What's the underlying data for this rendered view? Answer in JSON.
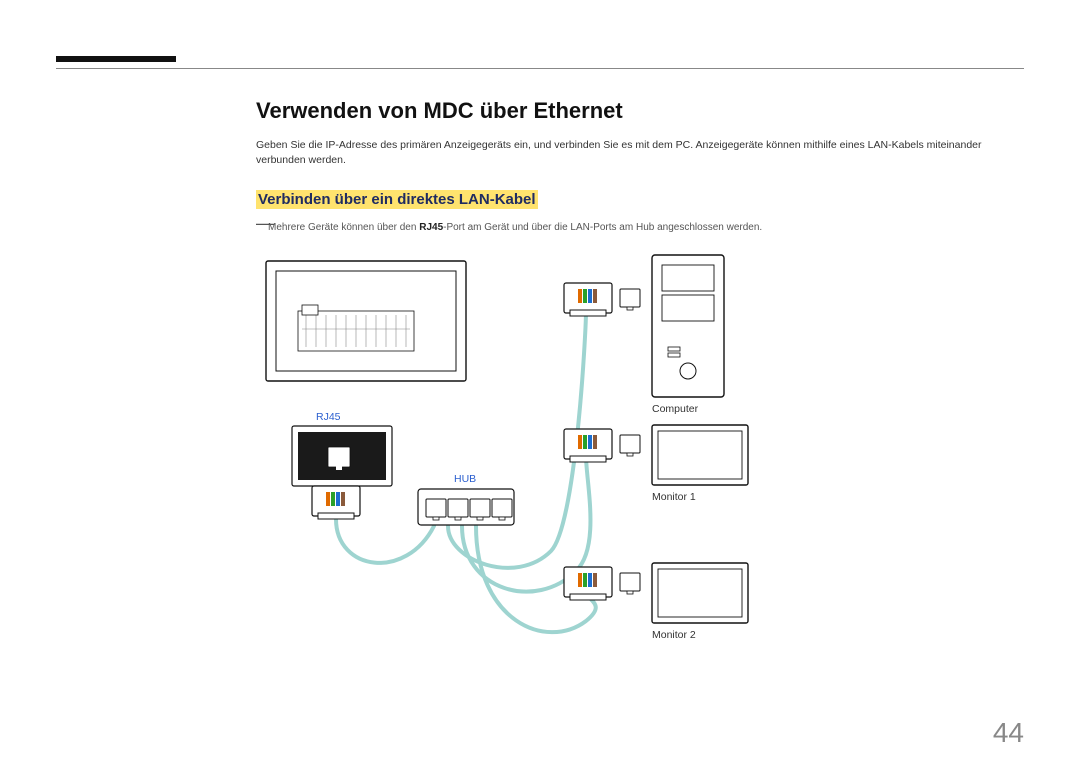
{
  "page": {
    "number": "44",
    "title": "Verwenden von MDC über Ethernet",
    "intro": "Geben Sie die IP-Adresse des primären Anzeigegeräts ein, und verbinden Sie es mit dem PC. Anzeigegeräte können mithilfe eines LAN-Kabels miteinander verbunden werden.",
    "subheading": "Verbinden über ein direktes LAN-Kabel",
    "note_prefix": "Mehrere Geräte können über den ",
    "note_bold": "RJ45",
    "note_suffix": "-Port am Gerät und über die LAN-Ports am Hub angeschlossen werden."
  },
  "diagram_labels": {
    "rj45": "RJ45",
    "hub": "HUB",
    "computer": "Computer",
    "monitor1": "Monitor 1",
    "monitor2": "Monitor 2"
  }
}
